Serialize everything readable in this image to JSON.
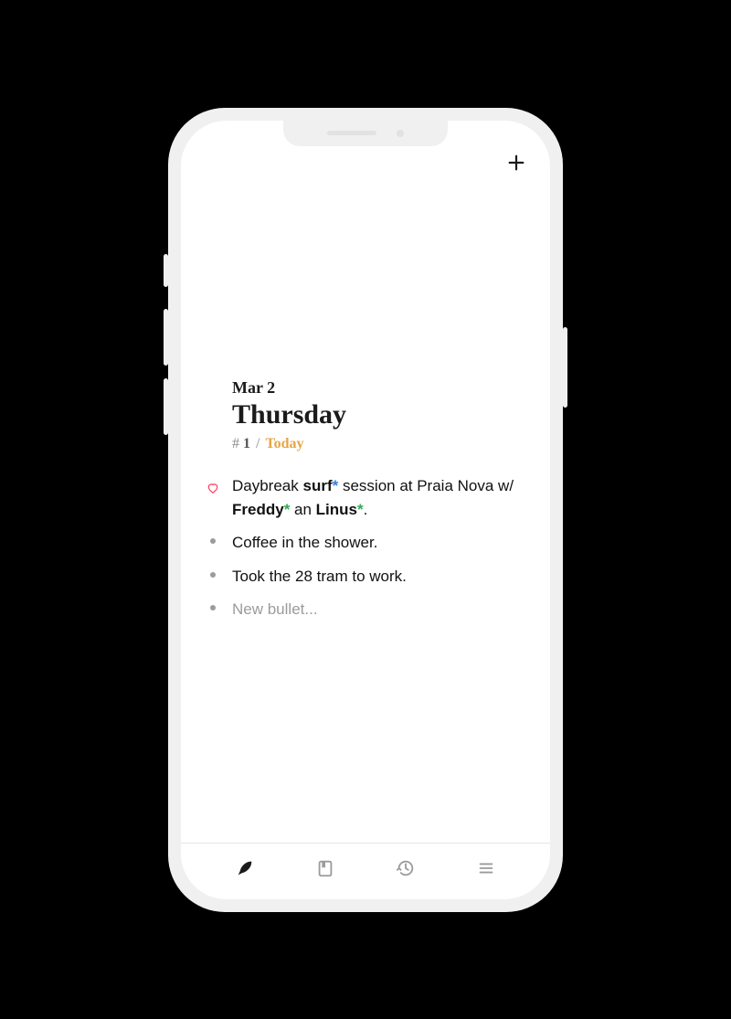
{
  "header": {
    "date_short": "Mar 2",
    "day_name": "Thursday",
    "hash_symbol": "#",
    "entry_number": "1",
    "separator": "/",
    "today_label": "Today"
  },
  "bullets": [
    {
      "marker": "heart",
      "segments": [
        {
          "t": "Daybreak ",
          "style": "plain"
        },
        {
          "t": "surf",
          "style": "bold"
        },
        {
          "t": "*",
          "style": "tag-blue"
        },
        {
          "t": " session at Praia Nova w/ ",
          "style": "plain"
        },
        {
          "t": "Freddy",
          "style": "bold"
        },
        {
          "t": "*",
          "style": "tag-green"
        },
        {
          "t": " an ",
          "style": "plain"
        },
        {
          "t": "Linus",
          "style": "bold"
        },
        {
          "t": "*",
          "style": "tag-green"
        },
        {
          "t": ".",
          "style": "plain"
        }
      ]
    },
    {
      "marker": "dot",
      "segments": [
        {
          "t": "Coffee in the shower.",
          "style": "plain"
        }
      ]
    },
    {
      "marker": "dot",
      "segments": [
        {
          "t": "Took the 28 tram to work.",
          "style": "plain"
        }
      ]
    }
  ],
  "new_bullet_placeholder": "New bullet...",
  "icons": {
    "add": "plus-icon",
    "tab_write": "feather-icon",
    "tab_bookmarks": "bookmark-icon",
    "tab_history": "history-icon",
    "tab_menu": "menu-icon"
  },
  "colors": {
    "accent_orange": "#e5a544",
    "tag_blue": "#2f7fe0",
    "tag_green": "#34a853",
    "heart_red": "#ff3b5c"
  }
}
